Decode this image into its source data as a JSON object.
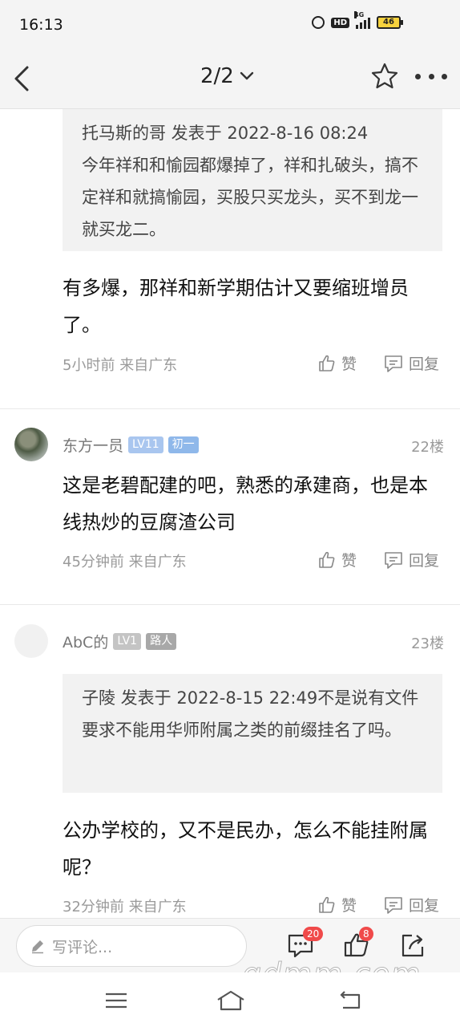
{
  "status_bar": {
    "time": "16:13",
    "hd": "HD",
    "network": "4G",
    "battery": "46"
  },
  "header": {
    "page": "2/2"
  },
  "posts": [
    {
      "quote": "托马斯的哥 发表于 2022-8-16 08:24\n今年祥和和愉园都爆掉了，祥和扎破头，搞不定祥和就搞愉园，买股只买龙头，买不到龙一就买龙二。",
      "text": "有多爆，那祥和新学期估计又要缩班增员了。",
      "time": "5小时前",
      "location": "来自广东",
      "like_label": "赞",
      "reply_label": "回复"
    },
    {
      "username": "东方一员",
      "level": "LV11",
      "rank": "初一",
      "floor": "22楼",
      "text": "这是老碧配建的吧，熟悉的承建商，也是本线热炒的豆腐渣公司",
      "time": "45分钟前",
      "location": "来自广东",
      "like_label": "赞",
      "reply_label": "回复"
    },
    {
      "username": "AbC的",
      "level": "LV1",
      "rank": "路人",
      "floor": "23楼",
      "quote": "子陵 发表于 2022-8-15 22:49不是说有文件要求不能用华师附属之类的前缀挂名了吗。",
      "text": "公办学校的，又不是民办，怎么不能挂附属呢？",
      "time": "32分钟前",
      "location": "来自广东",
      "like_label": "赞",
      "reply_label": "回复"
    }
  ],
  "bottom_bar": {
    "comment_placeholder": "写评论...",
    "comment_count": "20",
    "like_count": "8"
  },
  "watermark": "gdmm.com",
  "colors": {
    "badge_red": "#f04a4a",
    "level_badge": "#a9c6ef",
    "quote_bg": "#f2f2f2"
  }
}
